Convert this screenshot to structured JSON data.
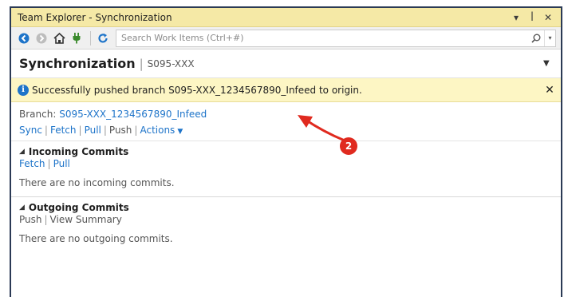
{
  "titlebar": {
    "title": "Team Explorer - Synchronization",
    "dropdown_icon": "chevron-down-icon",
    "pin_icon": "pin-icon",
    "close_icon": "close-icon"
  },
  "toolbar": {
    "search_placeholder": "Search Work Items (Ctrl+#)"
  },
  "heading": {
    "title": "Synchronization",
    "separator": "|",
    "subtitle": "S095-XXX"
  },
  "infobar": {
    "message": "Successfully pushed branch S095-XXX_1234567890_Infeed to origin.",
    "close_glyph": "✕"
  },
  "branch": {
    "label": "Branch:",
    "name": "S095-XXX_1234567890_Infeed"
  },
  "actions": {
    "sync": "Sync",
    "fetch": "Fetch",
    "pull": "Pull",
    "push": "Push",
    "actions": "Actions"
  },
  "incoming": {
    "title": "Incoming Commits",
    "fetch": "Fetch",
    "pull": "Pull",
    "empty": "There are no incoming commits."
  },
  "outgoing": {
    "title": "Outgoing Commits",
    "push": "Push",
    "view_summary": "View Summary",
    "empty": "There are no outgoing commits."
  },
  "annotation": {
    "badge": "2"
  },
  "colors": {
    "titlebar_bg": "#f5e9a6",
    "infobar_bg": "#fdf6c4",
    "link": "#1e74c9",
    "annotation_red": "#e02a1f"
  }
}
